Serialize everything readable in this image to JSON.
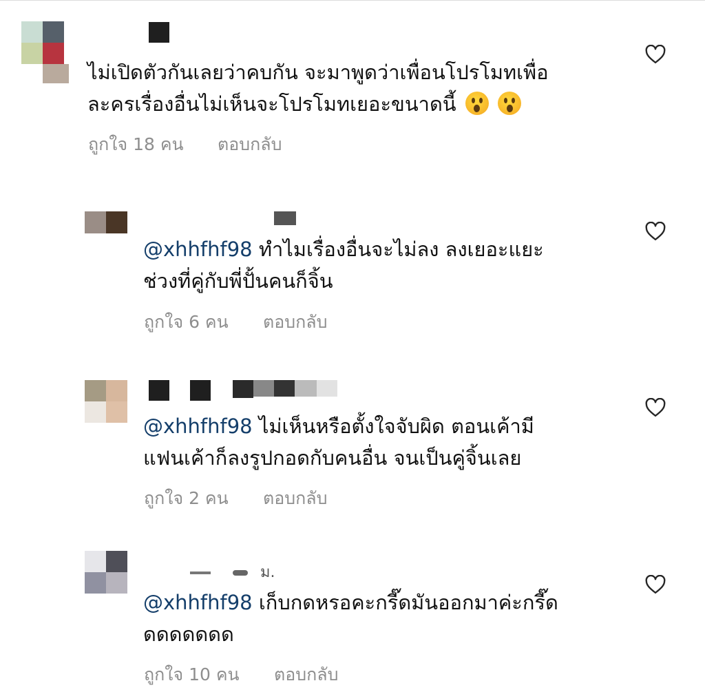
{
  "comments": [
    {
      "text_line1": "ไม่เปิดตัวกันเลยว่าคบกัน จะมาพูดว่าเพื่อนโปรโมทเพื่อ",
      "text_line2": "ละครเรื่องอื่นไม่เห็นจะโปรโมทเยอะขนาดนี้",
      "emojis": [
        "hushed-face",
        "hushed-face"
      ],
      "likes": "ถูกใจ 18 คน",
      "reply": "ตอบกลับ"
    },
    {
      "mention": "@xhhfhf98",
      "text_line1": " ทำไมเรื่องอื่นจะไม่ลง ลงเยอะแยะ",
      "text_line2": "ช่วงที่คู่กับพี่ปั้นคนก็จิ้น",
      "likes": "ถูกใจ 6 คน",
      "reply": "ตอบกลับ"
    },
    {
      "mention": "@xhhfhf98",
      "text_line1": " ไม่เห็นหรือตั้งใจจับผิด ตอนเค้ามี",
      "text_line2": "แฟนเค้าก็ลงรูปกอดกับคนอื่น จนเป็นคู่จิ้นเลย",
      "likes": "ถูกใจ 2 คน",
      "reply": "ตอบกลับ"
    },
    {
      "username_fragment": "ม.",
      "mention": "@xhhfhf98",
      "text_line1": " เก็บกดหรอคะกรี๊ดมันออกมาค่ะกรี๊ด",
      "text_line2": "ดดดดดดด",
      "likes": "ถูกใจ 10 คน",
      "reply": "ตอบกลับ"
    }
  ],
  "icons": {
    "like": "heart-outline-icon"
  },
  "colors": {
    "mention": "#143e6a",
    "meta": "#8e8e8e",
    "heart": "#262626"
  }
}
